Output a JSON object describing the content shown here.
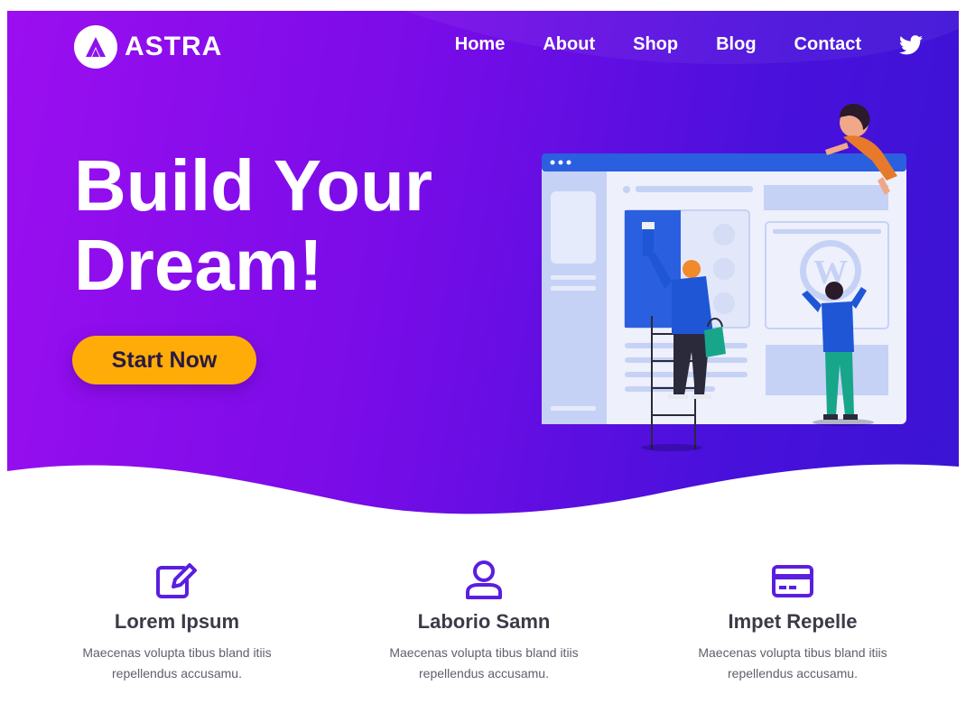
{
  "brand": {
    "name": "ASTRA",
    "logo_icon": "astra-logo-icon"
  },
  "nav": {
    "items": [
      "Home",
      "About",
      "Shop",
      "Blog",
      "Contact"
    ],
    "social_icon": "twitter-icon"
  },
  "hero": {
    "headline_line1": "Build Your",
    "headline_line2": "Dream!",
    "cta_label": "Start Now",
    "illustration": "website-builders-illustration",
    "illustration_logo": "wordpress-logo-icon"
  },
  "features": [
    {
      "icon": "edit-icon",
      "title": "Lorem Ipsum",
      "text_line1": "Maecenas volupta tibus bland itiis",
      "text_line2": "repellendus accusamu."
    },
    {
      "icon": "user-icon",
      "title": "Laborio Samn",
      "text_line1": "Maecenas volupta tibus bland itiis",
      "text_line2": "repellendus accusamu."
    },
    {
      "icon": "credit-card-icon",
      "title": "Impet Repelle",
      "text_line1": "Maecenas volupta tibus bland itiis",
      "text_line2": "repellendus accusamu."
    }
  ],
  "colors": {
    "hero_gradient_start": "#9b0ef0",
    "hero_gradient_end": "#3a14d4",
    "accent": "#ffac08",
    "icon_color": "#5a1ee0",
    "heading_text": "#3b3b48",
    "body_text": "#5f5f6a"
  }
}
